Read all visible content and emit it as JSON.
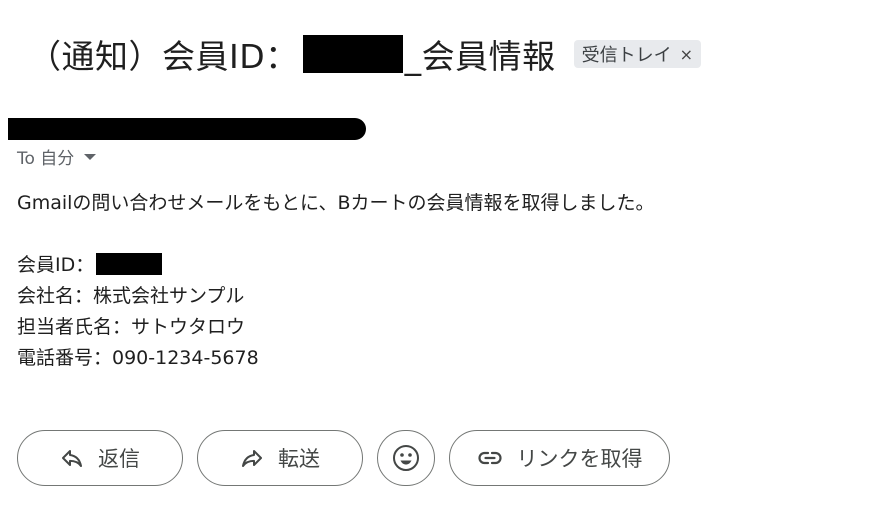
{
  "subject": {
    "prefix": "（通知）会員ID：",
    "suffix": "_会員情報",
    "label_chip": "受信トレイ",
    "label_remove": "×"
  },
  "to_line": {
    "label": "To 自分"
  },
  "body": {
    "intro": "Gmailの問い合わせメールをもとに、Bカートの会員情報を取得しました。",
    "member_id_label": "会員ID：",
    "company": "会社名：株式会社サンプル",
    "contact": "担当者氏名：サトウタロウ",
    "phone": "電話番号：090-1234-5678"
  },
  "actions": {
    "reply": "返信",
    "forward": "転送",
    "get_link": "リンクを取得"
  },
  "icons": {
    "reply": "reply-icon",
    "forward": "forward-icon",
    "emoji": "emoji-icon",
    "link": "link-icon",
    "caret": "caret-down-icon"
  },
  "colors": {
    "chip_bg": "#e8eaed",
    "button_border": "#747775",
    "redaction": "#000000"
  }
}
